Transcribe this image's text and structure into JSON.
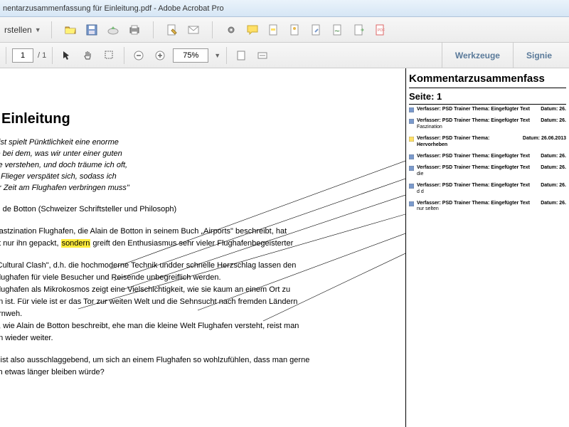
{
  "titlebar": "nentarzusammenfassung für Einleitung.pdf - Adobe Acrobat Pro",
  "toolbar1": {
    "left_label": "rstellen"
  },
  "toolbar2": {
    "page_current": "1",
    "page_total": "/ 1",
    "zoom": "75%",
    "tab_werkzeuge": "Werkzeuge",
    "tab_signieren": "Signie"
  },
  "doc": {
    "title": "Einleitung",
    "p1a": "eist spielt Pünktlichkeit eine enorme",
    "p1b": "le bei dem, was wir unter einer guten",
    "p1c": "se verstehen, und doch träume ich oft,",
    "p1d": "n Flieger verspätet sich, sodass ich",
    "p1e": "hr Zeit am Flughafen verbringen muss\"",
    "p2": "in de Botton (Schweizer Schriftsteller und Philosoph)",
    "p3a_prefix": " Fastzination Flughafen, die Alain de Botton in seinem Buch „Airports\" beschreibt, hat",
    "p3b_prefix": "ht nur ihn gepackt, ",
    "p3b_highlight": "sondern",
    "p3b_suffix": " greift den Enthusiasmus sehr vieler Flughafenbegeisterter",
    "p4a": " „Cultural  Clash\", d.h. die hochmoderne Technik undder schnelle Herzschlag lassen den",
    "p4b": " Flughafen für viele Besucher und Reisende unbegreiflich werden.",
    "p4c": " Flughafen als Mikrokosmos zeigt eine Vielschichtigkeit, wie sie kaum an einem Ort zu",
    "p4d": "en ist. Für viele ist er das Tor zur weiten Welt und die Sehnsucht nach fremden Ländern",
    "p4e": "ernweh.",
    "p4f": "h, wie Alain de Botton beschreibt, ehe man die kleine Welt Flughafen versteht, reist man",
    "p4g": "on wieder weiter.",
    "p5a": "s ist also ausschlaggebend, um sich an einem Flughafen so wohlzufühlen, dass man gerne",
    "p5b": "ch etwas länger bleiben würde?"
  },
  "sidebar": {
    "title": "Kommentarzusammenfass",
    "page_label": "Seite: 1",
    "comments": [
      {
        "author": "Verfasser: PSD Trainer",
        "topic": "Thema: Eingefügter Text",
        "date": "Datum: 26.",
        "extra": ""
      },
      {
        "author": "Verfasser: PSD Trainer",
        "topic": "Thema: Eingefügter Text",
        "date": "Datum: 26.",
        "extra": "Faszination"
      },
      {
        "author": "Verfasser: PSD Trainer",
        "topic": "Thema: Hervorheben",
        "date": "Datum: 26.06.2013",
        "extra": ""
      },
      {
        "author": "Verfasser: PSD Trainer",
        "topic": "Thema: Eingefügter Text",
        "date": "Datum: 26.",
        "extra": ""
      },
      {
        "author": "Verfasser: PSD Trainer",
        "topic": "Thema: Eingefügter Text",
        "date": "Datum: 26.",
        "extra": "die"
      },
      {
        "author": "Verfasser: PSD Trainer",
        "topic": "Thema: Eingefügter Text",
        "date": "Datum: 26.",
        "extra": "d d"
      },
      {
        "author": "Verfasser: PSD Trainer",
        "topic": "Thema: Eingefügter Text",
        "date": "Datum: 26.",
        "extra": "nur selten"
      }
    ]
  }
}
